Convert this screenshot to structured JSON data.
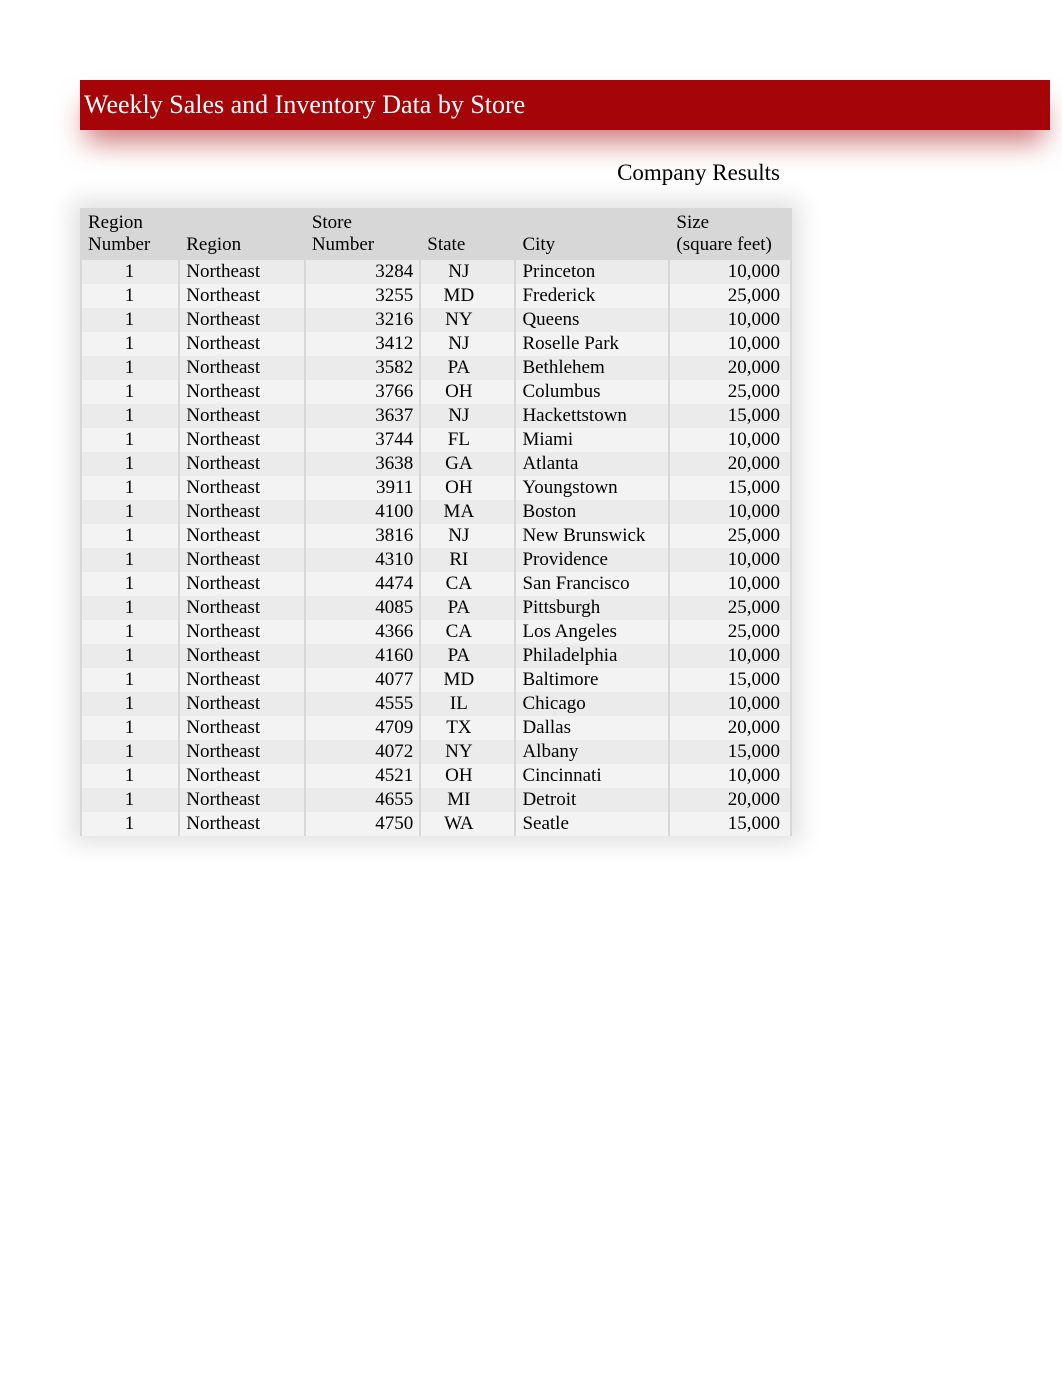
{
  "title": "Weekly Sales and Inventory Data by Store",
  "subtitle": "Company Results",
  "columns": {
    "region_number_l1": "Region",
    "region_number_l2": "Number",
    "region": "Region",
    "store_number_l1": "Store",
    "store_number_l2": "Number",
    "state": "State",
    "city": "City",
    "size_l1": "Size",
    "size_l2": "(square feet)"
  },
  "rows": [
    {
      "region_number": "1",
      "region": "Northeast",
      "store_number": "3284",
      "state": "NJ",
      "city": "Princeton",
      "size": "10,000"
    },
    {
      "region_number": "1",
      "region": "Northeast",
      "store_number": "3255",
      "state": "MD",
      "city": "Frederick",
      "size": "25,000"
    },
    {
      "region_number": "1",
      "region": "Northeast",
      "store_number": "3216",
      "state": "NY",
      "city": "Queens",
      "size": "10,000"
    },
    {
      "region_number": "1",
      "region": "Northeast",
      "store_number": "3412",
      "state": "NJ",
      "city": "Roselle Park",
      "size": "10,000"
    },
    {
      "region_number": "1",
      "region": "Northeast",
      "store_number": "3582",
      "state": "PA",
      "city": "Bethlehem",
      "size": "20,000"
    },
    {
      "region_number": "1",
      "region": "Northeast",
      "store_number": "3766",
      "state": "OH",
      "city": "Columbus",
      "size": "25,000"
    },
    {
      "region_number": "1",
      "region": "Northeast",
      "store_number": "3637",
      "state": "NJ",
      "city": "Hackettstown",
      "size": "15,000"
    },
    {
      "region_number": "1",
      "region": "Northeast",
      "store_number": "3744",
      "state": "FL",
      "city": "Miami",
      "size": "10,000"
    },
    {
      "region_number": "1",
      "region": "Northeast",
      "store_number": "3638",
      "state": "GA",
      "city": "Atlanta",
      "size": "20,000"
    },
    {
      "region_number": "1",
      "region": "Northeast",
      "store_number": "3911",
      "state": "OH",
      "city": "Youngstown",
      "size": "15,000"
    },
    {
      "region_number": "1",
      "region": "Northeast",
      "store_number": "4100",
      "state": "MA",
      "city": "Boston",
      "size": "10,000"
    },
    {
      "region_number": "1",
      "region": "Northeast",
      "store_number": "3816",
      "state": "NJ",
      "city": "New Brunswick",
      "size": "25,000"
    },
    {
      "region_number": "1",
      "region": "Northeast",
      "store_number": "4310",
      "state": "RI",
      "city": "Providence",
      "size": "10,000"
    },
    {
      "region_number": "1",
      "region": "Northeast",
      "store_number": "4474",
      "state": "CA",
      "city": "San Francisco",
      "size": "10,000"
    },
    {
      "region_number": "1",
      "region": "Northeast",
      "store_number": "4085",
      "state": "PA",
      "city": "Pittsburgh",
      "size": "25,000"
    },
    {
      "region_number": "1",
      "region": "Northeast",
      "store_number": "4366",
      "state": "CA",
      "city": "Los Angeles",
      "size": "25,000"
    },
    {
      "region_number": "1",
      "region": "Northeast",
      "store_number": "4160",
      "state": "PA",
      "city": "Philadelphia",
      "size": "10,000"
    },
    {
      "region_number": "1",
      "region": "Northeast",
      "store_number": "4077",
      "state": "MD",
      "city": "Baltimore",
      "size": "15,000"
    },
    {
      "region_number": "1",
      "region": "Northeast",
      "store_number": "4555",
      "state": "IL",
      "city": "Chicago",
      "size": "10,000"
    },
    {
      "region_number": "1",
      "region": "Northeast",
      "store_number": "4709",
      "state": "TX",
      "city": "Dallas",
      "size": "20,000"
    },
    {
      "region_number": "1",
      "region": "Northeast",
      "store_number": "4072",
      "state": "NY",
      "city": "Albany",
      "size": "15,000"
    },
    {
      "region_number": "1",
      "region": "Northeast",
      "store_number": "4521",
      "state": "OH",
      "city": "Cincinnati",
      "size": "10,000"
    },
    {
      "region_number": "1",
      "region": "Northeast",
      "store_number": "4655",
      "state": "MI",
      "city": "Detroit",
      "size": "20,000"
    },
    {
      "region_number": "1",
      "region": "Northeast",
      "store_number": "4750",
      "state": "WA",
      "city": "Seatle",
      "size": "15,000"
    }
  ]
}
